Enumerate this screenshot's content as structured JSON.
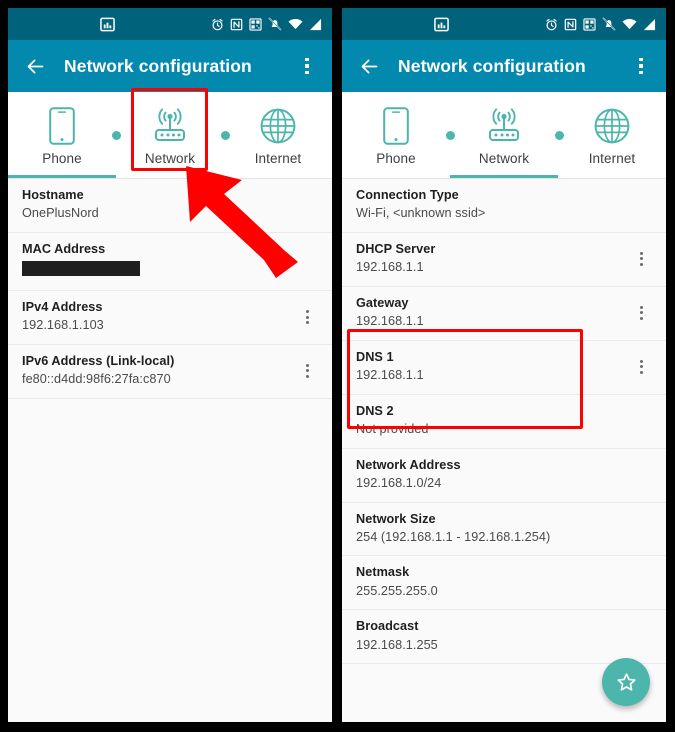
{
  "statusbar": {
    "icons_left": [
      "screenshot-icon"
    ],
    "icons_right": [
      "alarm-icon",
      "nfc-icon",
      "qr-scan-icon",
      "notifications-muted-icon",
      "wifi-icon",
      "signal-icon"
    ]
  },
  "appbar": {
    "title": "Network configuration",
    "back_icon": "back-arrow-icon",
    "overflow_icon": "overflow-menu-icon",
    "background": "#0389ad",
    "statusbar_background": "#01627b"
  },
  "tabs": {
    "items": [
      {
        "label": "Phone",
        "icon": "phone-icon"
      },
      {
        "label": "Network",
        "icon": "router-icon"
      },
      {
        "label": "Internet",
        "icon": "globe-icon"
      }
    ],
    "accent": "#4db6ac"
  },
  "fab": {
    "icon": "star-icon",
    "color": "#4db6ac"
  },
  "annotations": {
    "highlight_color": "#fe0000",
    "left_box_target": "network-tab",
    "left_arrow": "pointer-arrow-to-network-tab",
    "right_box_target": "dns-rows"
  },
  "panels": [
    {
      "id": "left-panel",
      "active_tab": "Phone",
      "rows": [
        {
          "title": "Hostname",
          "value": "OnePlusNord",
          "menu": false,
          "redacted": false
        },
        {
          "title": "MAC Address",
          "value": "",
          "menu": false,
          "redacted": true
        },
        {
          "title": "IPv4 Address",
          "value": "192.168.1.103",
          "menu": true,
          "redacted": false
        },
        {
          "title": "IPv6 Address (Link-local)",
          "value": "fe80::d4dd:98f6:27fa:c870",
          "menu": true,
          "redacted": false
        }
      ]
    },
    {
      "id": "right-panel",
      "active_tab": "Network",
      "rows": [
        {
          "title": "Connection Type",
          "value": "Wi-Fi, <unknown ssid>",
          "menu": false,
          "redacted": false
        },
        {
          "title": "DHCP Server",
          "value": "192.168.1.1",
          "menu": true,
          "redacted": false
        },
        {
          "title": "Gateway",
          "value": "192.168.1.1",
          "menu": true,
          "redacted": false
        },
        {
          "title": "DNS 1",
          "value": "192.168.1.1",
          "menu": true,
          "redacted": false
        },
        {
          "title": "DNS 2",
          "value": "Not provided",
          "menu": false,
          "redacted": false
        },
        {
          "title": "Network Address",
          "value": "192.168.1.0/24",
          "menu": false,
          "redacted": false
        },
        {
          "title": "Network Size",
          "value": "254 (192.168.1.1 - 192.168.1.254)",
          "menu": false,
          "redacted": false
        },
        {
          "title": "Netmask",
          "value": "255.255.255.0",
          "menu": false,
          "redacted": false
        },
        {
          "title": "Broadcast",
          "value": "192.168.1.255",
          "menu": false,
          "redacted": false
        }
      ]
    }
  ]
}
